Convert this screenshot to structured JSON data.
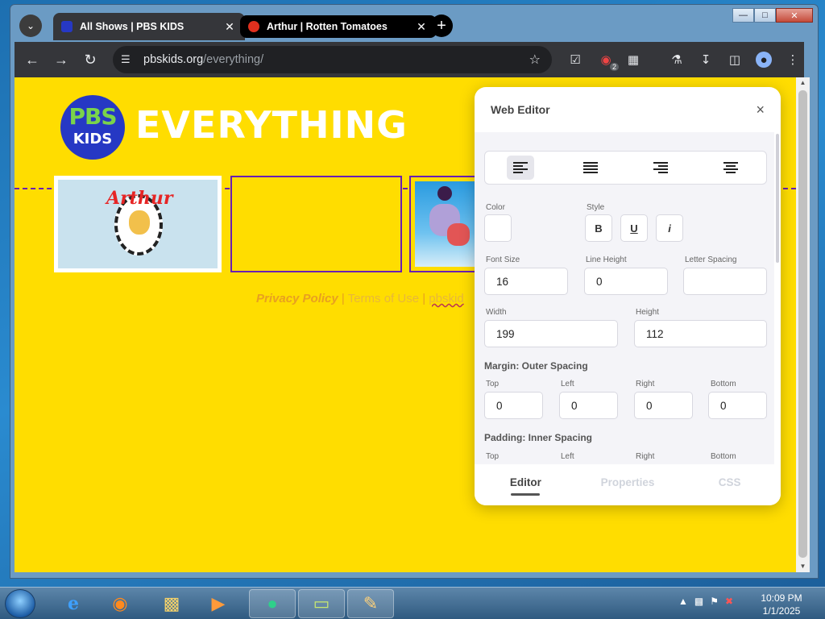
{
  "browser": {
    "tabs": [
      {
        "title": "All Shows | PBS KIDS",
        "active": true
      },
      {
        "title": "Arthur | Rotten Tomatoes",
        "active": false
      }
    ],
    "url_host": "pbskids.org",
    "url_path": "/everything/",
    "extension_badge": "2"
  },
  "page": {
    "logo_top": "PBS",
    "logo_bottom": "KIDS",
    "heading": "EVERYTHING",
    "arthur_title": "Arthur",
    "footer": {
      "privacy": "Privacy Policy",
      "sep1": " | ",
      "terms": "Terms of Use",
      "sep2": " | ",
      "more": "pbskid"
    }
  },
  "editor": {
    "title": "Web Editor",
    "close": "×",
    "labels": {
      "color": "Color",
      "style": "Style",
      "font_size": "Font Size",
      "line_height": "Line Height",
      "letter_spacing": "Letter Spacing",
      "width": "Width",
      "height": "Height",
      "margin": "Margin: Outer Spacing",
      "padding": "Padding: Inner Spacing",
      "top": "Top",
      "left": "Left",
      "right": "Right",
      "bottom": "Bottom"
    },
    "style_buttons": {
      "bold": "B",
      "underline": "U",
      "italic": "i"
    },
    "values": {
      "font_size": "16",
      "line_height": "0",
      "letter_spacing": "",
      "width": "199",
      "height": "112",
      "margin_top": "0",
      "margin_left": "0",
      "margin_right": "0",
      "margin_bottom": "0"
    },
    "tabs": [
      "Editor",
      "Properties",
      "CSS"
    ]
  },
  "taskbar": {
    "time": "10:09 PM",
    "date": "1/1/2025"
  },
  "colors": {
    "page_bg": "#ffdd00",
    "accent_purple": "#6a1fb2",
    "footer_orange": "#e8a020"
  }
}
